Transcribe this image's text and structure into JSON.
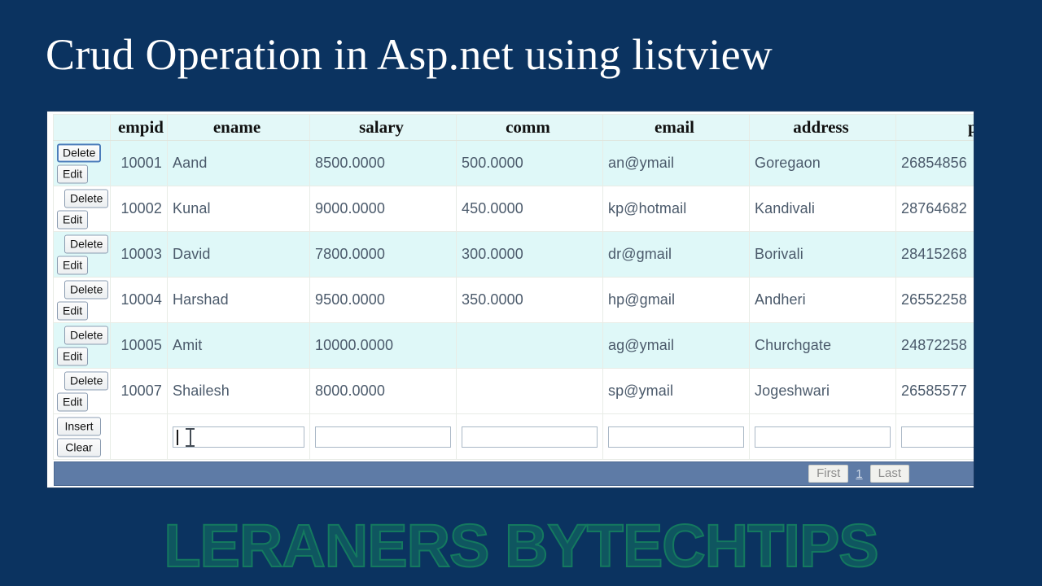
{
  "slide": {
    "title": "Crud Operation in Asp.net using listview",
    "background_color": "#0b3360",
    "title_color": "#ffffff",
    "watermark": "LERANERS BYTECHTIPS",
    "watermark_color": "#14795f"
  },
  "listview": {
    "headers": {
      "actions": "",
      "empid": "empid",
      "ename": "ename",
      "salary": "salary",
      "comm": "comm",
      "email": "email",
      "address": "address",
      "phone": "pho"
    },
    "row_buttons": {
      "delete": "Delete",
      "edit": "Edit"
    },
    "insert_buttons": {
      "insert": "Insert",
      "clear": "Clear"
    },
    "rows": [
      {
        "empid": "10001",
        "ename": "Aand",
        "salary": "8500.0000",
        "comm": "500.0000",
        "email": "an@ymail",
        "address": "Goregaon",
        "phone": "26854856"
      },
      {
        "empid": "10002",
        "ename": "Kunal",
        "salary": "9000.0000",
        "comm": "450.0000",
        "email": "kp@hotmail",
        "address": "Kandivali",
        "phone": "28764682"
      },
      {
        "empid": "10003",
        "ename": "David",
        "salary": "7800.0000",
        "comm": "300.0000",
        "email": "dr@gmail",
        "address": "Borivali",
        "phone": "28415268"
      },
      {
        "empid": "10004",
        "ename": "Harshad",
        "salary": "9500.0000",
        "comm": "350.0000",
        "email": "hp@gmail",
        "address": "Andheri",
        "phone": "26552258"
      },
      {
        "empid": "10005",
        "ename": "Amit",
        "salary": "10000.0000",
        "comm": "",
        "email": "ag@ymail",
        "address": "Churchgate",
        "phone": "24872258"
      },
      {
        "empid": "10007",
        "ename": "Shailesh",
        "salary": "8000.0000",
        "comm": "",
        "email": "sp@ymail",
        "address": "Jogeshwari",
        "phone": "26585577"
      }
    ],
    "insert_row": {
      "ename": "",
      "salary": "",
      "comm": "",
      "email": "",
      "address": "",
      "phone": ""
    },
    "pager": {
      "first": "First",
      "current_page": "1",
      "last": "Last",
      "bar_color": "#5e7ba6"
    },
    "colors": {
      "header_bg": "#e3f8f8",
      "row_alt_bg": "#dff8f8",
      "row_bg": "#ffffff",
      "text": "#4b5a6b",
      "focus_border": "#4c7dbb"
    }
  }
}
